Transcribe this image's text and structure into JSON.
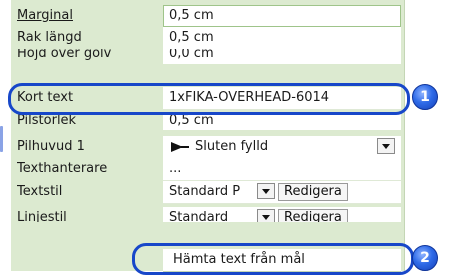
{
  "properties": [
    {
      "label": "Marginal",
      "value": "0,5 cm"
    },
    {
      "label": "Rak längd",
      "value": "0,5 cm"
    },
    {
      "label": "Höjd över golv",
      "value": "0,0 cm"
    },
    {
      "label": "Kort text",
      "value": "1xFIKA-OVERHEAD-6014"
    },
    {
      "label": "Pilstorlek",
      "value": "0,5 cm"
    },
    {
      "label": "Pilhuvud 1",
      "value": "Sluten fylld"
    },
    {
      "label": "Texthanterare",
      "value": "..."
    },
    {
      "label": "Textstil",
      "value": "Standard P"
    },
    {
      "label": "Linjestil",
      "value": "Standard"
    }
  ],
  "edit_label": "Redigera",
  "fetch_button_label": "Hämta text från mål",
  "callouts": [
    "1",
    "2"
  ],
  "icons": {
    "arrowhead": "filled-arrowhead-icon",
    "dropdown": "chevron-down-icon"
  },
  "colors": {
    "panel": "#dcead0",
    "highlight": "#1747c9",
    "badge": "#2f6be8"
  }
}
